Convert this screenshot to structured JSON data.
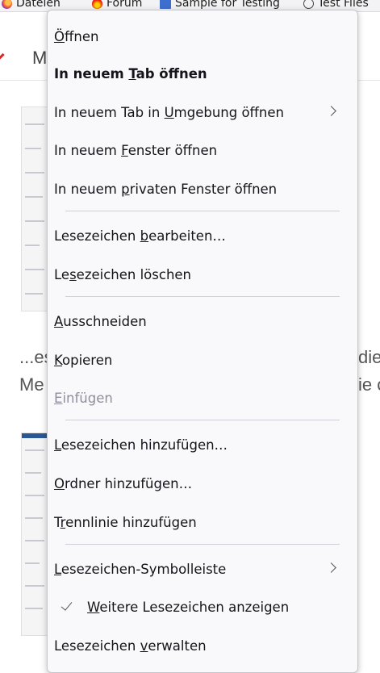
{
  "bookmarks_bar": {
    "items": [
      {
        "label": "Dateien",
        "icon": "firefox-icon"
      },
      {
        "label": "Forum",
        "icon": "flame-icon"
      },
      {
        "label": "Sample for Testing",
        "icon": "document-icon"
      },
      {
        "label": "Test Files",
        "icon": "globe-icon"
      }
    ]
  },
  "page": {
    "header_letter": "M",
    "text_line1": "...es",
    "text_line2": "Me",
    "text_right1": "die",
    "text_right2": "ie c"
  },
  "context_menu": {
    "items": [
      {
        "pre": "",
        "u": "Ö",
        "post": "ffnen"
      },
      {
        "pre": "In neuem ",
        "u": "T",
        "post": "ab öffnen"
      },
      {
        "pre": "In neuem Tab in ",
        "u": "U",
        "post": "mgebung öffnen"
      },
      {
        "pre": "In neuem ",
        "u": "F",
        "post": "enster öffnen"
      },
      {
        "pre": "In neuem ",
        "u": "p",
        "post": "rivaten Fenster öffnen"
      },
      {
        "pre": "Lesezeichen ",
        "u": "b",
        "post": "earbeiten…"
      },
      {
        "pre": "Le",
        "u": "s",
        "post": "ezeichen löschen"
      },
      {
        "pre": "",
        "u": "A",
        "post": "usschneiden"
      },
      {
        "pre": "",
        "u": "K",
        "post": "opieren"
      },
      {
        "pre": "",
        "u": "E",
        "post": "infügen"
      },
      {
        "pre": "",
        "u": "L",
        "post": "esezeichen hinzufügen…"
      },
      {
        "pre": "",
        "u": "O",
        "post": "rdner hinzufügen…"
      },
      {
        "pre": "T",
        "u": "r",
        "post": "ennlinie hinzufügen"
      },
      {
        "pre": "",
        "u": "L",
        "post": "esezeichen-Symbolleiste"
      },
      {
        "pre": "",
        "u": "W",
        "post": "eitere Lesezeichen anzeigen"
      },
      {
        "pre": "Lesezeichen ",
        "u": "v",
        "post": "erwalten"
      }
    ]
  }
}
